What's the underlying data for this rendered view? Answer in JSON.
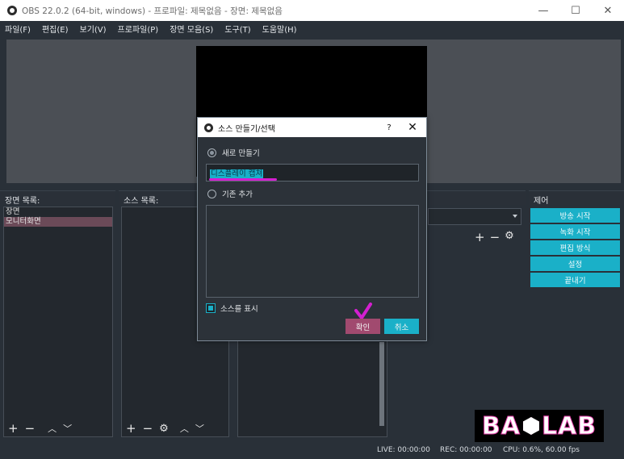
{
  "window": {
    "title": "OBS 22.0.2 (64-bit, windows) - 프로파일: 제목없음 - 장면: 제목없음",
    "minimize": "—",
    "maximize": "☐",
    "close": "✕"
  },
  "menu": [
    "파일(F)",
    "편집(E)",
    "보기(V)",
    "프로파일(P)",
    "장면 모음(S)",
    "도구(T)",
    "도움말(H)"
  ],
  "docks": {
    "scenes": {
      "title": "장면 목록:",
      "items": [
        "장면",
        "모니터화면"
      ],
      "selected_index": 1
    },
    "sources": {
      "title": "소스 목록:"
    },
    "controls": {
      "title": "제어",
      "buttons": [
        "방송 시작",
        "녹화 시작",
        "편집 방식",
        "설정",
        "끝내기"
      ]
    }
  },
  "toolbar_icons": {
    "add": "+",
    "remove": "−",
    "up": "︿",
    "down": "﹀",
    "gear": "⚙"
  },
  "status": {
    "live": "LIVE: 00:00:00",
    "rec": "REC: 00:00:00",
    "cpu": "CPU: 0.6%, 60.00 fps"
  },
  "logo": {
    "left": "BA",
    "right": "LAB"
  },
  "dialog": {
    "title": "소스 만들기/선택",
    "help": "?",
    "close": "✕",
    "create_new_label": "새로 만들기",
    "create_new_checked": true,
    "name_value": "디스플레이 캡쳐",
    "add_existing_label": "기존 추가",
    "add_existing_checked": false,
    "show_source_label": "소스를 표시",
    "show_source_checked": true,
    "ok_label": "확인",
    "cancel_label": "취소"
  },
  "colors": {
    "accent": "#1ab0c8",
    "ok": "#a14a6f",
    "annotation": "#d41fd0",
    "background": "#293038"
  }
}
